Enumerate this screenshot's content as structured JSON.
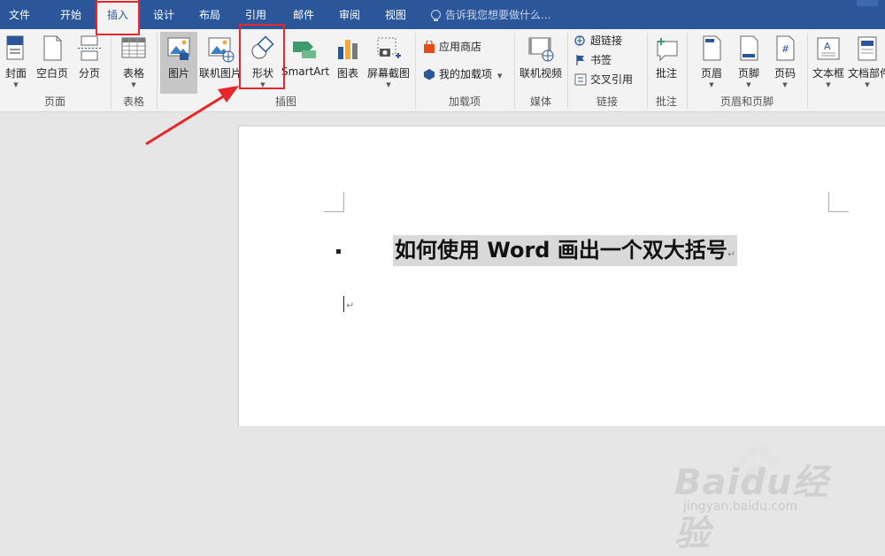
{
  "tabs": [
    "文件",
    "开始",
    "插入",
    "设计",
    "布局",
    "引用",
    "邮件",
    "审阅",
    "视图"
  ],
  "active_tab": "插入",
  "tell_me_placeholder": "告诉我您想要做什么...",
  "groups": {
    "pages": {
      "label": "页面",
      "cover": "封面",
      "blank": "空白页",
      "break": "分页"
    },
    "tables": {
      "label": "表格",
      "table": "表格"
    },
    "illustrations": {
      "label": "插图",
      "picture": "图片",
      "online_picture": "联机图片",
      "shapes": "形状",
      "smartart": "SmartArt",
      "chart": "图表",
      "screenshot": "屏幕截图"
    },
    "addins": {
      "label": "加载项",
      "store": "应用商店",
      "my_addins": "我的加载项"
    },
    "media": {
      "label": "媒体",
      "online_video": "联机视频"
    },
    "links": {
      "label": "链接",
      "hyperlink": "超链接",
      "bookmark": "书签",
      "cross_ref": "交叉引用"
    },
    "comments": {
      "label": "批注",
      "comment": "批注"
    },
    "header_footer": {
      "label": "页眉和页脚",
      "header": "页眉",
      "footer": "页脚",
      "page_number": "页码"
    },
    "text": {
      "textbox": "文本框",
      "docparts": "文档部件"
    }
  },
  "document": {
    "heading": "如何使用 Word 画出一个双大括号",
    "para_mark": "↵"
  },
  "watermark": {
    "brand": "Baidu经验",
    "url": "jingyan.baidu.com"
  },
  "colors": {
    "tabbar": "#2b579a",
    "highlight": "#e8262a",
    "arrow": "#e8262a"
  }
}
